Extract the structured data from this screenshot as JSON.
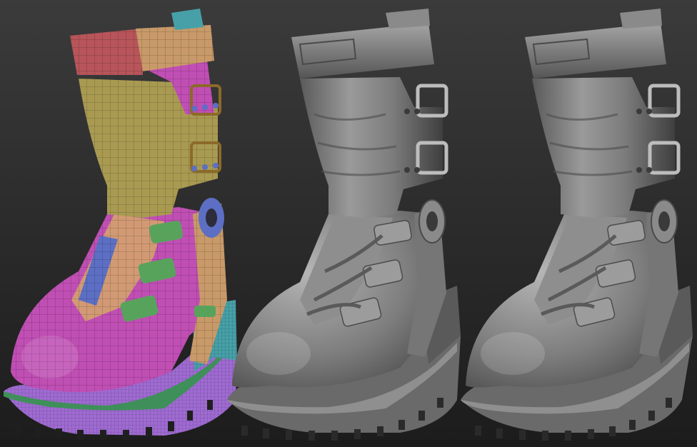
{
  "scene": {
    "description_visible_text": "",
    "background": {
      "top": "#3a3a3a",
      "bottom": "#1b1b1b"
    },
    "models": [
      {
        "id": "wireframe-polygroup-boot",
        "style": "polygroups"
      },
      {
        "id": "sculpt-boot-matcap",
        "style": "grey-matcap"
      },
      {
        "id": "sculpt-boot-final",
        "style": "grey-matcap"
      }
    ],
    "colors": {
      "cuff_red": "#b7555a",
      "cuff_tan": "#c99a69",
      "shaft_olive": "#a99a52",
      "upper_magenta": "#c04fb4",
      "lace_panel_peach": "#d29a74",
      "lace_blue": "#5c6fc4",
      "strap_green": "#58a35c",
      "sole_purple": "#9f6bd2",
      "welt_green": "#3f8f5a",
      "heel_cyan": "#47a0a8",
      "matcap_light": "#a8a8a8",
      "matcap_mid": "#7a7a7a",
      "matcap_dark": "#3e3e3e"
    }
  }
}
